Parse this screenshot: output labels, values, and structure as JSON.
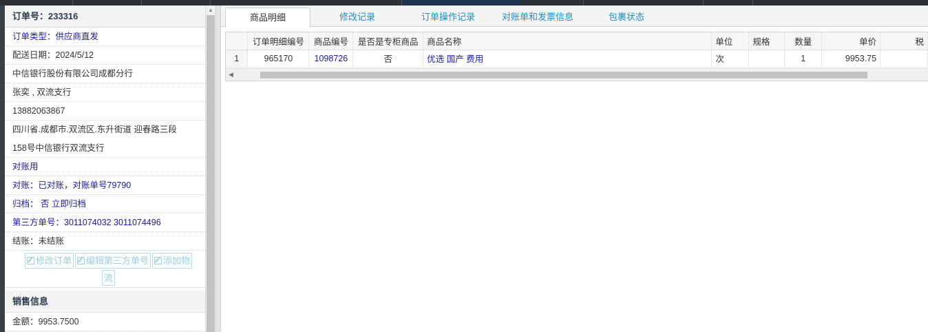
{
  "order_panel": {
    "order_no": "订单号：233316",
    "order_type": "订单类型：供应商直发",
    "delivery_date": "配送日期：2024/5/12",
    "company": "中信银行股份有限公司成都分行",
    "contact": "张奕 , 双流支行",
    "phone": "13882063867",
    "address_line1": "四川省.成都市.双流区.东升街道 迎春路三段",
    "address_line2": "158号中信银行双流支行",
    "reconcile_use": "对账用",
    "reconcile": "对账：已对账，对账单号79790",
    "archive": "归档： 否 立即归档",
    "third_party": "第三方单号：3011074032 3011074496",
    "settlement": "结账：未结账",
    "buttons": {
      "edit_order": "修改订单",
      "edit_third": "编辑第三方单号",
      "add_logistics_1": "添加物",
      "add_logistics_2": "流"
    },
    "sales_header": "销售信息",
    "amount": "金额：9953.7500"
  },
  "tabs": [
    "商品明细",
    "修改记录",
    "订单操作记录",
    "对账单和发票信息",
    "包裹状态"
  ],
  "table": {
    "columns": [
      "订单明细编号",
      "商品编号",
      "是否是专柜商品",
      "商品名称",
      "单位",
      "规格",
      "数量",
      "单价",
      "税"
    ],
    "rows": [
      {
        "index": "1",
        "detail_no": "965170",
        "product_no": "1098726",
        "counter": "否",
        "name": "优选 国产 费用",
        "unit": "次",
        "spec": "",
        "qty": "1",
        "price": "9953.75",
        "tax": ""
      }
    ]
  }
}
